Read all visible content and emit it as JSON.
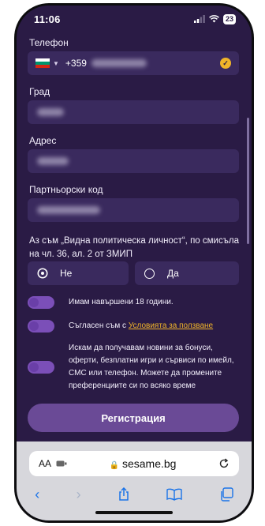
{
  "status": {
    "time": "11:06",
    "battery": "23"
  },
  "form": {
    "phone_label": "Телефон",
    "phone_prefix": "+359",
    "city_label": "Град",
    "address_label": "Адрес",
    "partner_label": "Партньорски код",
    "pep_question": "Аз съм „Видна политическа личност“, по смисъла на чл. 36, ал. 2 от ЗМИП",
    "pep_no": "Не",
    "pep_yes": "Да",
    "pep_selected": "Не",
    "age_toggle": "Имам навършени 18 години.",
    "terms_prefix": "Съгласен съм с ",
    "terms_link": "Условията за ползване",
    "news_toggle": "Искам да получавам новини за бонуси, оферти, безплатни игри и сървиси по имейл, СМС или телефон. Можете да промените преференциите си по всяко време",
    "register_button": "Регистрация"
  },
  "browser": {
    "text_size": "AA",
    "url": "sesame.bg"
  },
  "colors": {
    "background": "#2a1b45",
    "field": "#3a2a5e",
    "accent": "#f0b429",
    "toggle": "#7b4fb8",
    "button": "#6a4a96"
  },
  "icons": [
    "signal-icon",
    "wifi-icon",
    "bulgaria-flag-icon",
    "chevron-down-icon",
    "check-circle-icon",
    "extensions-icon",
    "lock-icon",
    "reload-icon",
    "back-icon",
    "forward-icon",
    "share-icon",
    "bookmarks-icon",
    "tabs-icon"
  ]
}
